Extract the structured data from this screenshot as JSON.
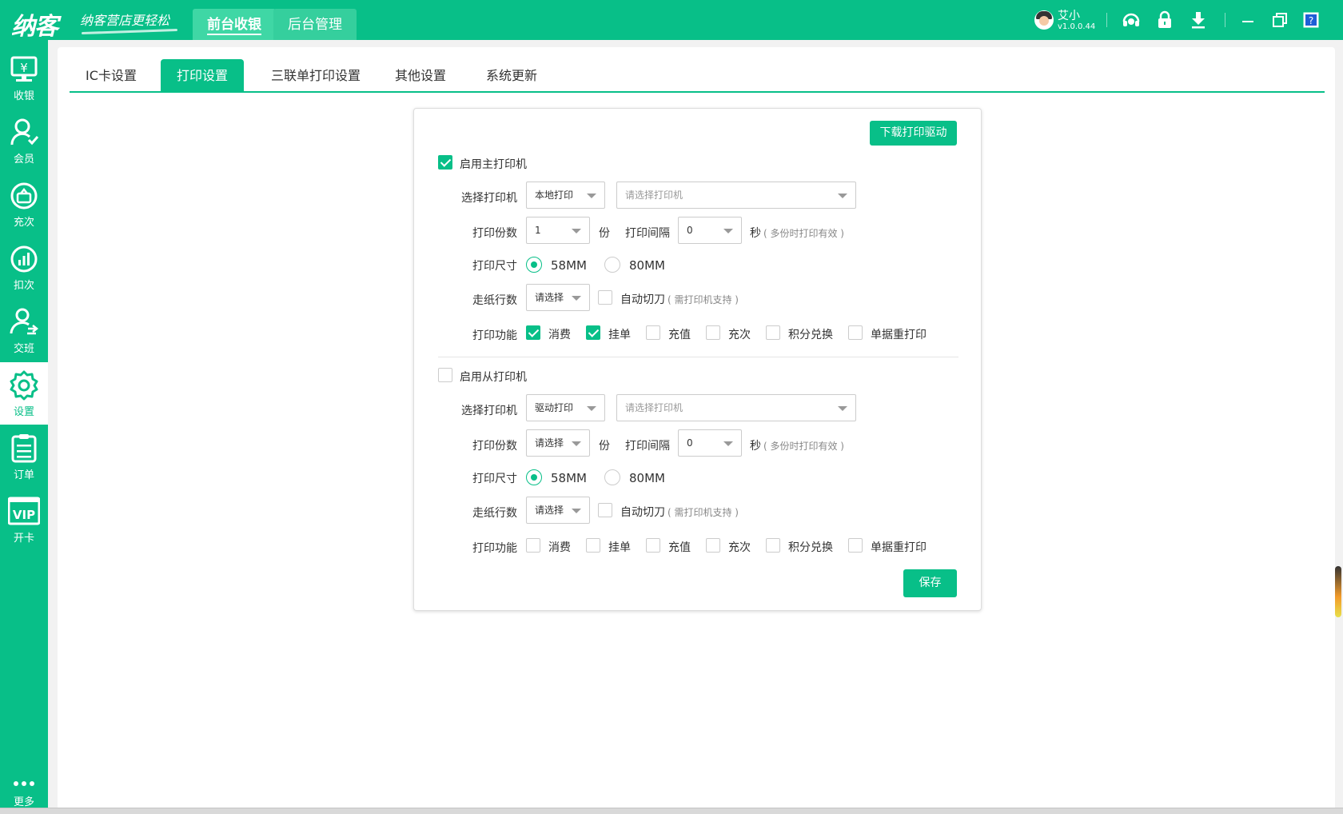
{
  "header": {
    "logo": "纳客",
    "slogan": "纳客营店更轻松",
    "nav": [
      {
        "label": "前台收银",
        "active": true
      },
      {
        "label": "后台管理",
        "active": false
      }
    ],
    "user": {
      "name": "艾小",
      "version": "v1.0.0.44"
    },
    "icons": [
      "headset-icon",
      "lock-icon",
      "download-icon",
      "minimize-icon",
      "restore-icon",
      "help-icon"
    ]
  },
  "sidebar": {
    "items": [
      {
        "label": "收银",
        "icon": "cashier-icon"
      },
      {
        "label": "会员",
        "icon": "member-icon"
      },
      {
        "label": "充次",
        "icon": "recharge-count-icon"
      },
      {
        "label": "扣次",
        "icon": "deduct-count-icon"
      },
      {
        "label": "交班",
        "icon": "handover-icon"
      },
      {
        "label": "设置",
        "icon": "gear-icon",
        "active": true
      },
      {
        "label": "订单",
        "icon": "order-icon"
      },
      {
        "label": "开卡",
        "icon": "vip-card-icon"
      }
    ],
    "more": "更多"
  },
  "tabs": [
    {
      "label": "IC卡设置",
      "active": false
    },
    {
      "label": "打印设置",
      "active": true
    },
    {
      "label": "三联单打印设置",
      "active": false
    },
    {
      "label": "其他设置",
      "active": false
    },
    {
      "label": "系统更新",
      "active": false
    }
  ],
  "panel": {
    "download_driver": "下载打印驱动",
    "save": "保存",
    "labels": {
      "select_printer": "选择打印机",
      "copies": "打印份数",
      "copies_unit": "份",
      "interval": "打印间隔",
      "interval_unit": "秒",
      "interval_note": "( 多份时打印有效 )",
      "size": "打印尺寸",
      "feed": "走纸行数",
      "auto_cut": "自动切刀",
      "auto_cut_note": "( 需打印机支持 )",
      "functions": "打印功能"
    },
    "size_options": [
      "58MM",
      "80MM"
    ],
    "function_options": [
      "消费",
      "挂单",
      "充值",
      "充次",
      "积分兑换",
      "单据重打印"
    ],
    "printer_placeholder": "请选择打印机",
    "main": {
      "title": "启用主打印机",
      "enabled": true,
      "mode": "本地打印",
      "copies": "1",
      "interval": "0",
      "size": "58MM",
      "feed": "请选择",
      "auto_cut": false,
      "functions": [
        true,
        true,
        false,
        false,
        false,
        false
      ]
    },
    "secondary": {
      "title": "启用从打印机",
      "enabled": false,
      "mode": "驱动打印",
      "copies": "请选择",
      "interval": "0",
      "size": "58MM",
      "feed": "请选择",
      "auto_cut": false,
      "functions": [
        false,
        false,
        false,
        false,
        false,
        false
      ]
    }
  },
  "colors": {
    "brand": "#08bf88",
    "background": "#f2f2f2"
  }
}
